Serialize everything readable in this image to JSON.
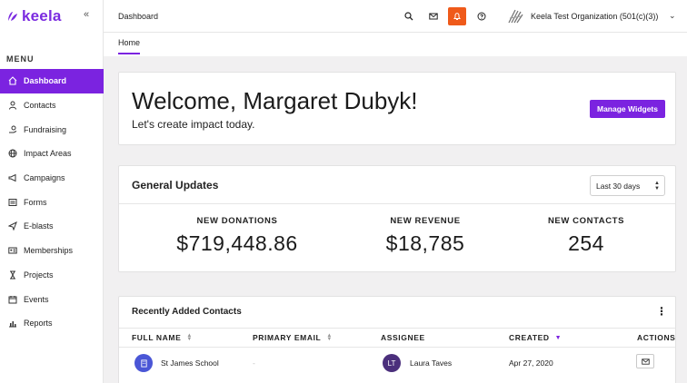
{
  "brand": {
    "name": "keela",
    "accent": "#7b23e0",
    "alert": "#ef5a1a"
  },
  "sidebar": {
    "menu_label": "MENU",
    "collapse_icon": "double-chevron-left-icon",
    "items": [
      {
        "label": "Dashboard",
        "icon": "home-icon",
        "active": true
      },
      {
        "label": "Contacts",
        "icon": "person-icon"
      },
      {
        "label": "Fundraising",
        "icon": "hand-coin-icon"
      },
      {
        "label": "Impact Areas",
        "icon": "globe-icon"
      },
      {
        "label": "Campaigns",
        "icon": "megaphone-icon"
      },
      {
        "label": "Forms",
        "icon": "form-icon"
      },
      {
        "label": "E-blasts",
        "icon": "paper-plane-icon"
      },
      {
        "label": "Memberships",
        "icon": "id-card-icon"
      },
      {
        "label": "Projects",
        "icon": "hourglass-icon"
      },
      {
        "label": "Events",
        "icon": "calendar-icon"
      },
      {
        "label": "Reports",
        "icon": "bar-chart-icon"
      }
    ]
  },
  "topbar": {
    "breadcrumb": "Dashboard",
    "org_name": "Keela Test Organization (501(c)(3))",
    "icons": [
      "search-icon",
      "mail-icon",
      "bell-icon",
      "help-icon"
    ]
  },
  "tabs": {
    "home": "Home"
  },
  "welcome": {
    "title": "Welcome, Margaret Dubyk!",
    "subtitle": "Let's create impact today.",
    "button": "Manage Widgets"
  },
  "updates": {
    "title": "General Updates",
    "period": "Last 30 days",
    "stats": [
      {
        "label": "NEW DONATIONS",
        "value": "$719,448.86"
      },
      {
        "label": "NEW REVENUE",
        "value": "$18,785"
      },
      {
        "label": "NEW CONTACTS",
        "value": "254"
      }
    ]
  },
  "contacts": {
    "title": "Recently Added Contacts",
    "columns": {
      "full_name": "FULL NAME",
      "email": "PRIMARY EMAIL",
      "assignee": "ASSIGNEE",
      "created": "CREATED",
      "actions": "ACTIONS"
    },
    "rows": [
      {
        "name": "St James School",
        "email": "-",
        "assignee_initials": "LT",
        "assignee": "Laura Taves",
        "created": "Apr 27, 2020"
      }
    ]
  }
}
